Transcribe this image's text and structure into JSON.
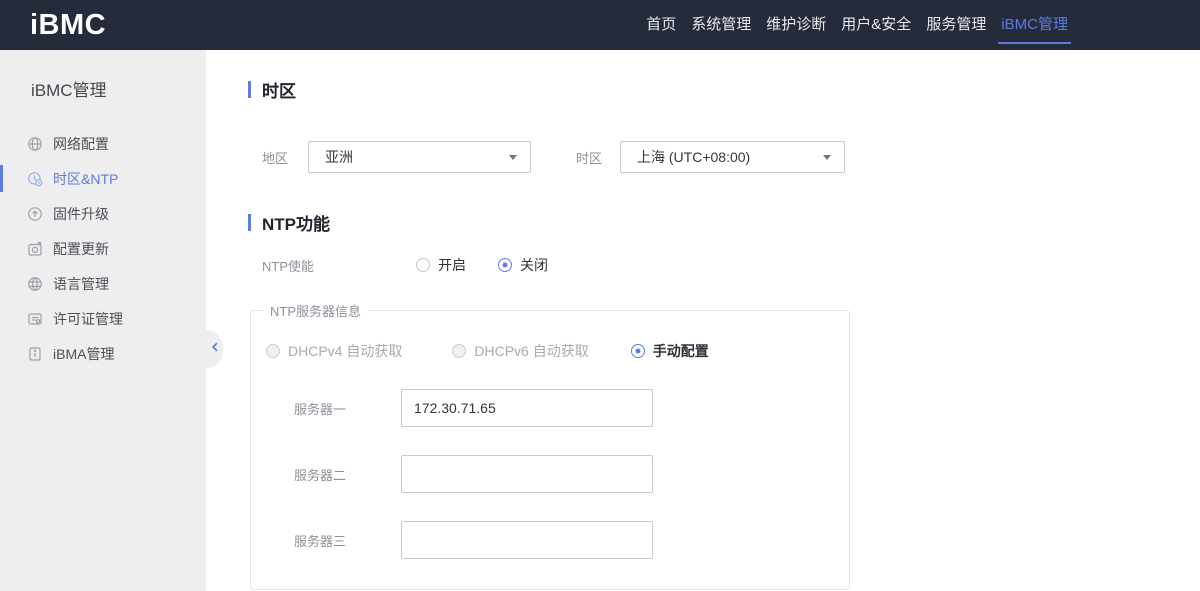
{
  "topbar": {
    "logo": "iBMC",
    "nav": [
      {
        "label": "首页",
        "active": false
      },
      {
        "label": "系统管理",
        "active": false
      },
      {
        "label": "维护诊断",
        "active": false
      },
      {
        "label": "用户&安全",
        "active": false
      },
      {
        "label": "服务管理",
        "active": false
      },
      {
        "label": "iBMC管理",
        "active": true
      }
    ]
  },
  "sidebar": {
    "title": "iBMC管理",
    "items": [
      {
        "label": "网络配置",
        "icon": "network-icon",
        "active": false
      },
      {
        "label": "时区&NTP",
        "icon": "clock-icon",
        "active": true
      },
      {
        "label": "固件升级",
        "icon": "firmware-upgrade-icon",
        "active": false
      },
      {
        "label": "配置更新",
        "icon": "config-update-icon",
        "active": false
      },
      {
        "label": "语言管理",
        "icon": "language-icon",
        "active": false
      },
      {
        "label": "许可证管理",
        "icon": "license-icon",
        "active": false
      },
      {
        "label": "iBMA管理",
        "icon": "ibma-icon",
        "active": false
      }
    ]
  },
  "main": {
    "timezone_section": {
      "title": "时区",
      "region_label": "地区",
      "region_value": "亚洲",
      "timezone_label": "时区",
      "timezone_value": "上海 (UTC+08:00)"
    },
    "ntp_section": {
      "title": "NTP功能",
      "enable_label": "NTP使能",
      "enable_options": [
        {
          "label": "开启",
          "selected": false
        },
        {
          "label": "关闭",
          "selected": true
        }
      ],
      "server_group": {
        "legend": "NTP服务器信息",
        "mode_options": [
          {
            "label": "DHCPv4 自动获取",
            "selected": false,
            "disabled": true
          },
          {
            "label": "DHCPv6 自动获取",
            "selected": false,
            "disabled": true
          },
          {
            "label": "手动配置",
            "selected": true,
            "disabled": false
          }
        ],
        "servers": [
          {
            "label": "服务器一",
            "value": "172.30.71.65"
          },
          {
            "label": "服务器二",
            "value": ""
          },
          {
            "label": "服务器三",
            "value": ""
          }
        ]
      }
    }
  },
  "colors": {
    "accent": "#5e7ce0",
    "topbar_bg": "#252b3a",
    "sidebar_bg": "#eeeeee"
  }
}
